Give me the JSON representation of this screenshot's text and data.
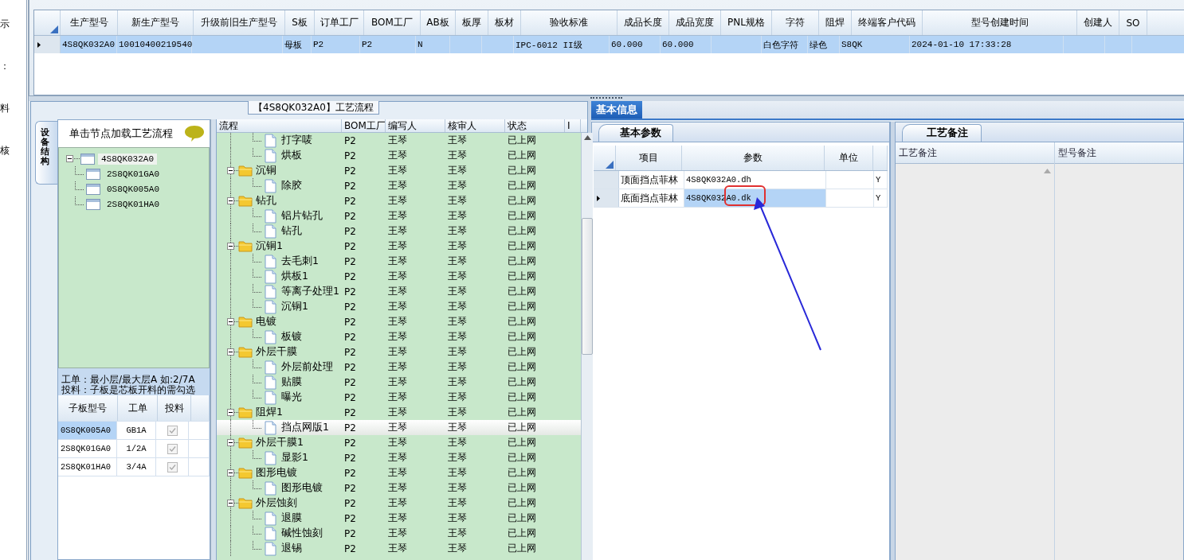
{
  "side_menu": [
    "示",
    "：",
    "料",
    "核"
  ],
  "main_table": {
    "columns": [
      "生产型号",
      "新生产型号",
      "升级前旧生产型号",
      "S板",
      "订单工厂",
      "BOM工厂",
      "AB板",
      "板厚",
      "板材",
      "验收标准",
      "成品长度",
      "成品宽度",
      "PNL规格",
      "字符",
      "阻焊",
      "终端客户代码",
      "型号创建时间",
      "创建人",
      "SO"
    ],
    "rows": [
      {
        "selected": true,
        "cells": [
          "4S8QK032A0",
          "10010400219540",
          "",
          "母板",
          "P2",
          "P2",
          "N",
          "",
          "",
          "IPC-6012 II级",
          "60.000",
          "60.000",
          "",
          "白色字符",
          "绿色",
          "S8QK",
          "2024-01-10 17:33:28",
          "",
          ""
        ]
      }
    ]
  },
  "process_panel": {
    "title": "【4S8QK032A0】工艺流程",
    "side_tab": "设备结构",
    "tree_hint": "单击节点加载工艺流程",
    "board_tree": [
      {
        "label": "4S8QK032A0",
        "selected": true,
        "expanded": true,
        "children": [
          {
            "label": "2S8QK01GA0",
            "selected": false
          },
          {
            "label": "0S8QK005A0",
            "selected": false
          },
          {
            "label": "2S8QK01HA0",
            "selected": false
          }
        ]
      }
    ],
    "notes": [
      "工单：最小层/最大层A 如:2/7A",
      "投料：子板是芯板开料的需勾选"
    ],
    "sub_boards": {
      "columns": [
        "子板型号",
        "工单",
        "投料"
      ],
      "rows": [
        {
          "board": "0S8QK005A0",
          "order": "GB1A",
          "checked": true,
          "selected": true
        },
        {
          "board": "2S8QK01GA0",
          "order": "1/2A",
          "checked": true,
          "selected": false
        },
        {
          "board": "2S8QK01HA0",
          "order": "3/4A",
          "checked": true,
          "selected": false
        }
      ]
    },
    "steps_columns": [
      "流程",
      "BOM工厂",
      "编写人",
      "核审人",
      "状态",
      "I"
    ],
    "steps": [
      {
        "children": [
          {
            "label": "打字唛",
            "bom": "P2",
            "writer": "王琴",
            "reviewer": "王琴",
            "status": "已上网",
            "selected": false
          },
          {
            "label": "烘板",
            "bom": "P2",
            "writer": "王琴",
            "reviewer": "王琴",
            "status": "已上网",
            "selected": false
          }
        ]
      },
      {
        "label": "沉铜",
        "bom": "P2",
        "writer": "王琴",
        "reviewer": "王琴",
        "status": "已上网",
        "selected": false,
        "expanded": true,
        "children": [
          {
            "label": "除胶",
            "bom": "P2",
            "writer": "王琴",
            "reviewer": "王琴",
            "status": "已上网",
            "selected": false
          }
        ]
      },
      {
        "label": "钻孔",
        "bom": "P2",
        "writer": "王琴",
        "reviewer": "王琴",
        "status": "已上网",
        "selected": false,
        "expanded": true,
        "children": [
          {
            "label": "铝片钻孔",
            "bom": "P2",
            "writer": "王琴",
            "reviewer": "王琴",
            "status": "已上网",
            "selected": false
          },
          {
            "label": "钻孔",
            "bom": "P2",
            "writer": "王琴",
            "reviewer": "王琴",
            "status": "已上网",
            "selected": false
          }
        ]
      },
      {
        "label": "沉铜1",
        "bom": "P2",
        "writer": "王琴",
        "reviewer": "王琴",
        "status": "已上网",
        "selected": false,
        "expanded": true,
        "children": [
          {
            "label": "去毛刺1",
            "bom": "P2",
            "writer": "王琴",
            "reviewer": "王琴",
            "status": "已上网",
            "selected": false
          },
          {
            "label": "烘板1",
            "bom": "P2",
            "writer": "王琴",
            "reviewer": "王琴",
            "status": "已上网",
            "selected": false
          },
          {
            "label": "等离子处理1",
            "bom": "P2",
            "writer": "王琴",
            "reviewer": "王琴",
            "status": "已上网",
            "selected": false
          },
          {
            "label": "沉铜1",
            "bom": "P2",
            "writer": "王琴",
            "reviewer": "王琴",
            "status": "已上网",
            "selected": false
          }
        ]
      },
      {
        "label": "电镀",
        "bom": "P2",
        "writer": "王琴",
        "reviewer": "王琴",
        "status": "已上网",
        "selected": false,
        "expanded": true,
        "children": [
          {
            "label": "板镀",
            "bom": "P2",
            "writer": "王琴",
            "reviewer": "王琴",
            "status": "已上网",
            "selected": false
          }
        ]
      },
      {
        "label": "外层干膜",
        "bom": "P2",
        "writer": "王琴",
        "reviewer": "王琴",
        "status": "已上网",
        "selected": false,
        "expanded": true,
        "children": [
          {
            "label": "外层前处理",
            "bom": "P2",
            "writer": "王琴",
            "reviewer": "王琴",
            "status": "已上网",
            "selected": false
          },
          {
            "label": "贴膜",
            "bom": "P2",
            "writer": "王琴",
            "reviewer": "王琴",
            "status": "已上网",
            "selected": false
          },
          {
            "label": "曝光",
            "bom": "P2",
            "writer": "王琴",
            "reviewer": "王琴",
            "status": "已上网",
            "selected": false
          }
        ]
      },
      {
        "label": "阻焊1",
        "bom": "P2",
        "writer": "王琴",
        "reviewer": "王琴",
        "status": "已上网",
        "selected": false,
        "expanded": true,
        "children": [
          {
            "label": "挡点网版1",
            "bom": "P2",
            "writer": "王琴",
            "reviewer": "王琴",
            "status": "已上网",
            "selected": true
          }
        ]
      },
      {
        "label": "外层干膜1",
        "bom": "P2",
        "writer": "王琴",
        "reviewer": "王琴",
        "status": "已上网",
        "selected": false,
        "expanded": true,
        "children": [
          {
            "label": "显影1",
            "bom": "P2",
            "writer": "王琴",
            "reviewer": "王琴",
            "status": "已上网",
            "selected": false
          }
        ]
      },
      {
        "label": "图形电镀",
        "bom": "P2",
        "writer": "王琴",
        "reviewer": "王琴",
        "status": "已上网",
        "selected": false,
        "expanded": true,
        "children": [
          {
            "label": "图形电镀",
            "bom": "P2",
            "writer": "王琴",
            "reviewer": "王琴",
            "status": "已上网",
            "selected": false
          }
        ]
      },
      {
        "label": "外层蚀刻",
        "bom": "P2",
        "writer": "王琴",
        "reviewer": "王琴",
        "status": "已上网",
        "selected": false,
        "expanded": true,
        "children": [
          {
            "label": "退膜",
            "bom": "P2",
            "writer": "王琴",
            "reviewer": "王琴",
            "status": "已上网",
            "selected": false
          },
          {
            "label": "碱性蚀刻",
            "bom": "P2",
            "writer": "王琴",
            "reviewer": "王琴",
            "status": "已上网",
            "selected": false
          },
          {
            "label": "退锡",
            "bom": "P2",
            "writer": "王琴",
            "reviewer": "王琴",
            "status": "已上网",
            "selected": false
          }
        ]
      }
    ]
  },
  "info_tab": "基本信息",
  "params": {
    "tab": "基本参数",
    "columns": [
      "项目",
      "参数",
      "单位"
    ],
    "rows": [
      {
        "item": "顶面挡点菲林",
        "value": "4S8QK032A0.dh",
        "unit": "",
        "column_5": "Y",
        "selected": false
      },
      {
        "item": "底面挡点菲林",
        "value": "4S8QK032A0.dk",
        "unit": "",
        "column_5": "Y",
        "selected": true
      }
    ]
  },
  "remarks": {
    "tab": "工艺备注",
    "columns": [
      "工艺备注",
      "型号备注"
    ]
  }
}
